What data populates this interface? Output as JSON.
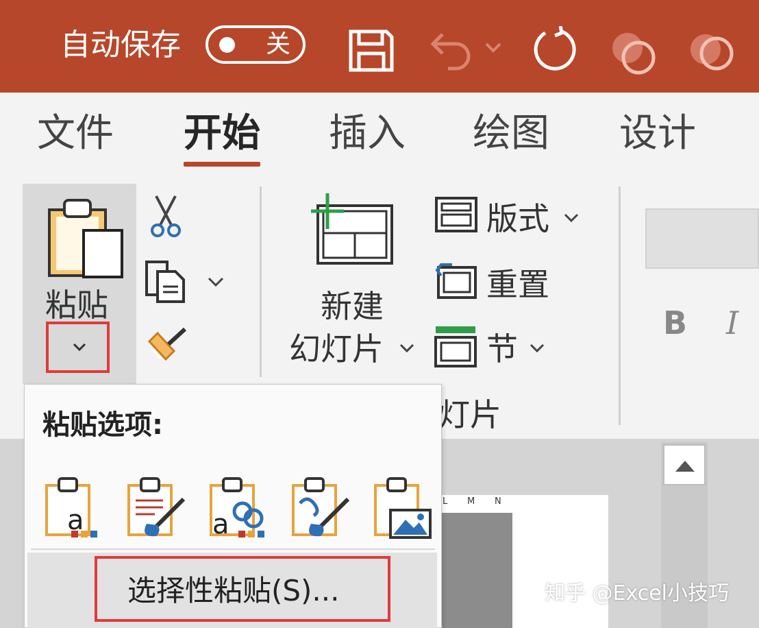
{
  "title_bar": {
    "autosave_label": "自动保存",
    "autosave_state": "关",
    "icons": [
      "save-icon",
      "undo-icon",
      "dropdown-chevron-icon",
      "redo-icon",
      "shapes-icon",
      "shapes-icon-2"
    ],
    "background_color": "#b7472a"
  },
  "tabs": [
    {
      "label": "文件",
      "active": false
    },
    {
      "label": "开始",
      "active": true
    },
    {
      "label": "插入",
      "active": false
    },
    {
      "label": "绘图",
      "active": false
    },
    {
      "label": "设计",
      "active": false
    }
  ],
  "ribbon": {
    "paste_label": "粘贴",
    "clipboard_icons": [
      "scissors-icon",
      "copy-icon",
      "format-painter-icon"
    ],
    "new_slide_line1": "新建",
    "new_slide_line2": "幻灯片",
    "layout_label": "版式",
    "reset_label": "重置",
    "section_label": "节",
    "group_label_partial": "灯片",
    "bold_label": "B",
    "italic_label": "I"
  },
  "paste_dropdown": {
    "title": "粘贴选项:",
    "options": [
      "use-destination-theme-icon",
      "keep-source-formatting-icon",
      "embed-icon",
      "keep-text-only-icon",
      "picture-icon"
    ],
    "menu_item": "选择性粘贴(S)..."
  },
  "slide_preview": {
    "column_headers": [
      "L",
      "M",
      "N"
    ]
  },
  "watermark": "知乎 @Excel小技巧",
  "colors": {
    "accent": "#b7472a",
    "highlight_box": "#e03a3a",
    "green_plus": "#2e9e48",
    "orange_icon": "#e8a33d",
    "blue_icon": "#2f6fb3"
  }
}
